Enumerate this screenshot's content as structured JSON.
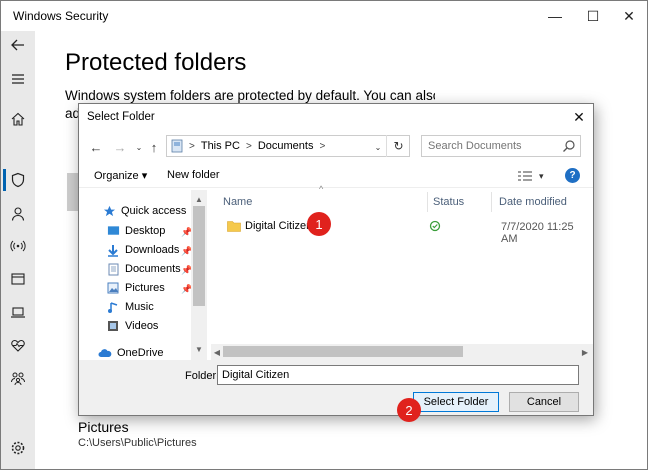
{
  "window": {
    "title": "Windows Security",
    "min_glyph": "—",
    "max_glyph": "☐",
    "close_glyph": "✕"
  },
  "sidebar": {
    "icons": [
      "back-arrow-icon",
      "menu-icon",
      "home-icon",
      "shield-icon",
      "person-icon",
      "wireless-icon",
      "browser-window-icon",
      "laptop-icon",
      "heart-icon",
      "family-icon",
      "settings-icon"
    ]
  },
  "page": {
    "title": "Protected folders",
    "description_line1": "Windows system folders are protected by default. You can also add",
    "description_line2": "ad"
  },
  "folder_entry": {
    "title": "Pictures",
    "path": "C:\\Users\\Public\\Pictures"
  },
  "dialog": {
    "title": "Select Folder",
    "close_glyph": "✕",
    "address": {
      "root": "This PC",
      "folder": "Documents"
    },
    "search": {
      "placeholder": "Search Documents"
    },
    "toolbar": {
      "organize": "Organize ▾",
      "new_folder": "New folder",
      "views_glyph": "▾",
      "help": "?"
    },
    "nav_items": [
      {
        "label": "Quick access",
        "icon": "star-icon",
        "pinned": false
      },
      {
        "label": "Desktop",
        "icon": "desktop-icon",
        "pinned": true
      },
      {
        "label": "Downloads",
        "icon": "download-icon",
        "pinned": true
      },
      {
        "label": "Documents",
        "icon": "documents-icon",
        "pinned": true
      },
      {
        "label": "Pictures",
        "icon": "pictures-icon",
        "pinned": true
      },
      {
        "label": "Music",
        "icon": "music-icon",
        "pinned": false
      },
      {
        "label": "Videos",
        "icon": "videos-icon",
        "pinned": false
      },
      {
        "label": "OneDrive",
        "icon": "cloud-icon",
        "pinned": false
      }
    ],
    "columns": {
      "name": "Name",
      "status": "Status",
      "date_modified": "Date modified"
    },
    "rows": [
      {
        "name": "Digital Citizen",
        "date": "7/7/2020 11:25 AM"
      }
    ],
    "folder_label": "Folder:",
    "folder_value": "Digital Citizen",
    "select_button": "Select Folder",
    "cancel_button": "Cancel"
  },
  "markers": [
    "1",
    "2"
  ],
  "colors": {
    "accent": "#0078d7",
    "marker": "#e0221d",
    "folder": "#f5c94c",
    "status_ok": "#3a9d3a"
  }
}
